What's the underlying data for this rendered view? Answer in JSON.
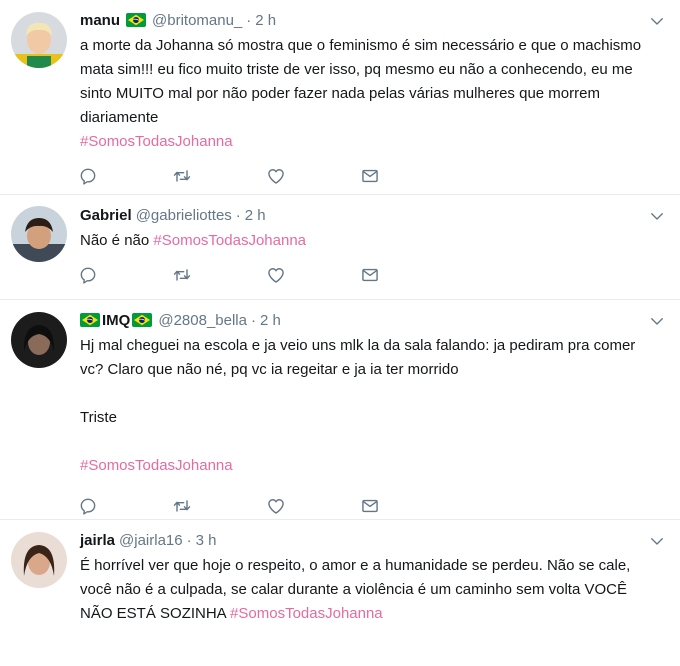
{
  "tweets": [
    {
      "name": "manu",
      "handle": "@britomanu_",
      "dot": "·",
      "time": "2 h",
      "text": "a morte da Johanna só mostra que o feminismo é sim necessário e que o machismo mata sim!!! eu fico muito triste de ver isso, pq mesmo eu não a conhecendo, eu me sinto MUITO mal por não poder fazer nada pelas várias mulheres que morrem diariamente",
      "hashtag": "#SomosTodasJohanna"
    },
    {
      "name": "Gabriel",
      "handle": "@gabrieliottes",
      "dot": "·",
      "time": "2 h",
      "text": "Não é não",
      "hashtag": "#SomosTodasJohanna"
    },
    {
      "name": "IMQ",
      "handle": "@2808_bella",
      "dot": "·",
      "time": "2 h",
      "text": "Hj mal cheguei na escola e ja veio uns mlk la da sala falando: ja pediram pra comer vc? Claro que não né, pq vc ia regeitar e ja ia ter morrido",
      "text2": "Triste",
      "hashtag": "#SomosTodasJohanna"
    },
    {
      "name": "jairla",
      "handle": "@jairla16",
      "dot": "·",
      "time": "3 h",
      "text": "É horrível ver que hoje o respeito, o amor e a humanidade se perdeu. Não se cale, você não é a culpada, se calar durante a violência é um caminho sem volta VOCÊ NÃO ESTÁ SOZINHA",
      "hashtag": "#SomosTodasJohanna"
    }
  ],
  "colors": {
    "hashtag": "#e66ba0",
    "muted": "#657786",
    "divider": "#e6ecf0"
  },
  "icons": [
    "reply-icon",
    "retweet-icon",
    "like-icon",
    "message-icon",
    "chevron-down-icon",
    "brazil-flag-icon"
  ]
}
